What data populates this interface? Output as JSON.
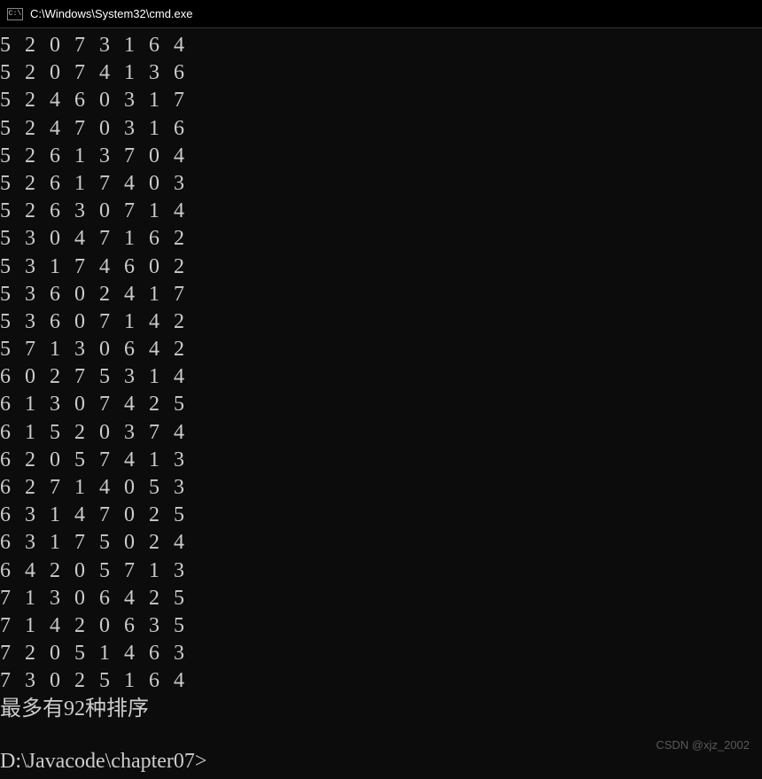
{
  "window": {
    "title": "C:\\Windows\\System32\\cmd.exe",
    "icon_label": "C:\\"
  },
  "output": {
    "rows": [
      [
        5,
        2,
        0,
        7,
        3,
        1,
        6,
        4
      ],
      [
        5,
        2,
        0,
        7,
        4,
        1,
        3,
        6
      ],
      [
        5,
        2,
        4,
        6,
        0,
        3,
        1,
        7
      ],
      [
        5,
        2,
        4,
        7,
        0,
        3,
        1,
        6
      ],
      [
        5,
        2,
        6,
        1,
        3,
        7,
        0,
        4
      ],
      [
        5,
        2,
        6,
        1,
        7,
        4,
        0,
        3
      ],
      [
        5,
        2,
        6,
        3,
        0,
        7,
        1,
        4
      ],
      [
        5,
        3,
        0,
        4,
        7,
        1,
        6,
        2
      ],
      [
        5,
        3,
        1,
        7,
        4,
        6,
        0,
        2
      ],
      [
        5,
        3,
        6,
        0,
        2,
        4,
        1,
        7
      ],
      [
        5,
        3,
        6,
        0,
        7,
        1,
        4,
        2
      ],
      [
        5,
        7,
        1,
        3,
        0,
        6,
        4,
        2
      ],
      [
        6,
        0,
        2,
        7,
        5,
        3,
        1,
        4
      ],
      [
        6,
        1,
        3,
        0,
        7,
        4,
        2,
        5
      ],
      [
        6,
        1,
        5,
        2,
        0,
        3,
        7,
        4
      ],
      [
        6,
        2,
        0,
        5,
        7,
        4,
        1,
        3
      ],
      [
        6,
        2,
        7,
        1,
        4,
        0,
        5,
        3
      ],
      [
        6,
        3,
        1,
        4,
        7,
        0,
        2,
        5
      ],
      [
        6,
        3,
        1,
        7,
        5,
        0,
        2,
        4
      ],
      [
        6,
        4,
        2,
        0,
        5,
        7,
        1,
        3
      ],
      [
        7,
        1,
        3,
        0,
        6,
        4,
        2,
        5
      ],
      [
        7,
        1,
        4,
        2,
        0,
        6,
        3,
        5
      ],
      [
        7,
        2,
        0,
        5,
        1,
        4,
        6,
        3
      ],
      [
        7,
        3,
        0,
        2,
        5,
        1,
        6,
        4
      ]
    ],
    "summary": "最多有92种排序",
    "prompt": "D:\\Javacode\\chapter07>"
  },
  "watermark": "CSDN @xjz_2002"
}
